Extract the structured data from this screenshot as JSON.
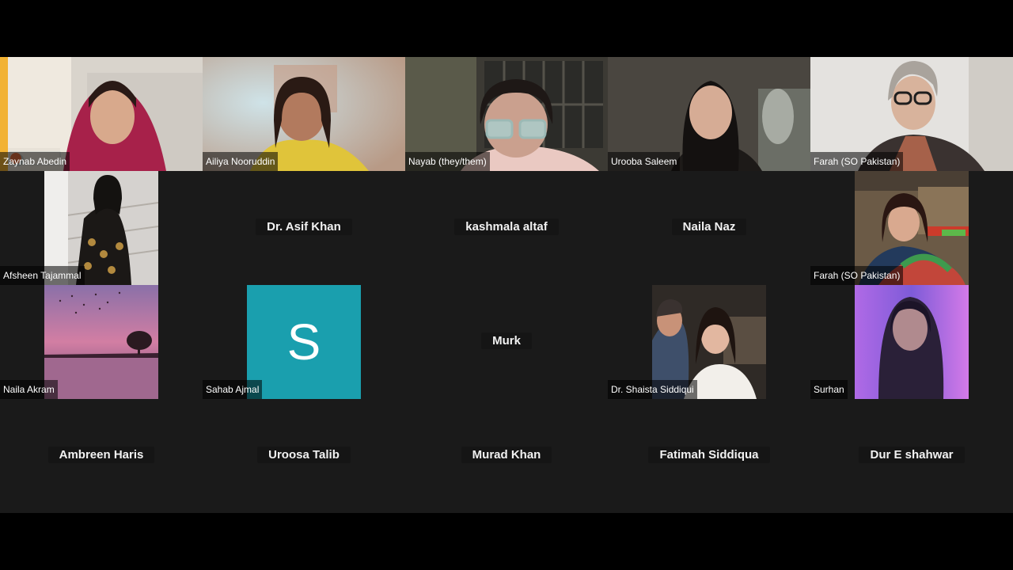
{
  "participants": [
    {
      "name": "Zaynab Abedin"
    },
    {
      "name": "Ailiya Nooruddin"
    },
    {
      "name": "Nayab (they/them)"
    },
    {
      "name": "Urooba Saleem"
    },
    {
      "name": "Farah (SO Pakistan)"
    },
    {
      "name": "Afsheen Tajammal"
    },
    {
      "name": "Dr. Asif Khan"
    },
    {
      "name": "kashmala altaf"
    },
    {
      "name": "Naila Naz"
    },
    {
      "name": "Farah (SO Pakistan)"
    },
    {
      "name": "Naila Akram"
    },
    {
      "name": "Sahab Ajmal",
      "avatar_letter": "S",
      "avatar_color": "#1a9fae"
    },
    {
      "name": "Murk"
    },
    {
      "name": "Dr. Shaista Siddiqui"
    },
    {
      "name": "Surhan"
    },
    {
      "name": "Ambreen Haris"
    },
    {
      "name": "Uroosa Talib"
    },
    {
      "name": "Murad Khan"
    },
    {
      "name": "Fatimah Siddiqua"
    },
    {
      "name": "Dur E shahwar"
    }
  ]
}
